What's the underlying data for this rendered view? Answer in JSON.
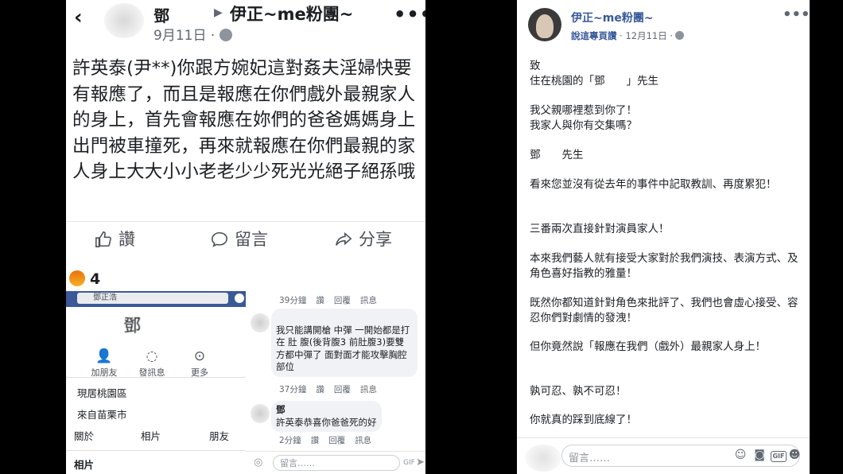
{
  "left_post": {
    "author": "鄧",
    "group": "伊正~me粉團~",
    "date": "9月11日 ·",
    "text": "許英泰(尹**)你跟方婉妃這對姦夫淫婦快要有報應了，而且是報應在你們戲外最親家人的身上，首先會報應在妳們的爸爸媽媽身上出門被車撞死，再來就報應在你們最親的家人身上大大小小老老少少死光光絕子絕孫哦",
    "actions": {
      "like": "讚",
      "comment": "留言",
      "share": "分享"
    },
    "reaction_count": "4",
    "reaction_icon": "angry-emoji-icon"
  },
  "profile_shot": {
    "search_text": "鄧正浩",
    "name": "鄧",
    "actions": [
      {
        "label": "加朋友",
        "icon": "add-friend-icon"
      },
      {
        "label": "發訊息",
        "icon": "messenger-icon"
      },
      {
        "label": "更多",
        "icon": "more-icon"
      }
    ],
    "info": [
      "現居桃園區",
      "來自苗栗市"
    ],
    "tabs": [
      "關於",
      "相片",
      "朋友"
    ],
    "bottom": "相片"
  },
  "comments_shot": {
    "meta1": {
      "time": "39分鐘",
      "like": "讚",
      "reply": "回覆",
      "msg": "訊息"
    },
    "comment1": "我只能講開槍 中彈 一開始都是打在 肚 腹(後背腹3 前肚腹3)要雙方都中彈了 面對面才能攻擊胸腔部位",
    "meta2": {
      "time": "37分鐘",
      "like": "讚",
      "reply": "回覆",
      "msg": "訊息"
    },
    "comment2_name": "鄧",
    "comment2": "許英泰恭喜你爸爸死的好",
    "meta3": {
      "time": "2分鐘",
      "like": "讚",
      "reply": "回覆",
      "msg": "訊息"
    },
    "input_placeholder": "留言……"
  },
  "right_post": {
    "page": "伊正~me粉團~",
    "sub_link": "說這專頁讚",
    "date": " · 12月11日 ·",
    "paragraphs": [
      "致\n住在桃園的「鄧　　」先生",
      "我父親哪裡惹到你了！\n我家人與你有交集嗎？",
      "鄧　　先生",
      "看來您並沒有從去年的事件中記取教訓、再度累犯！",
      "三番兩次直接針對演員家人！",
      "本來我們藝人就有接受大家對於我們演技、表演方式、及角色喜好指教的雅量！",
      "既然你都知道針對角色來批評了、我們也會虛心接受、容忍你們對劇情的發洩！",
      "但你竟然說「報應在我們（戲外）最親家人身上！",
      "孰可忍、孰不可忍！",
      "你就真的踩到底線了！"
    ],
    "input_placeholder": "留言……",
    "input_icons": [
      "emoji-icon",
      "camera-icon",
      "gif-icon",
      "sticker-icon"
    ]
  }
}
